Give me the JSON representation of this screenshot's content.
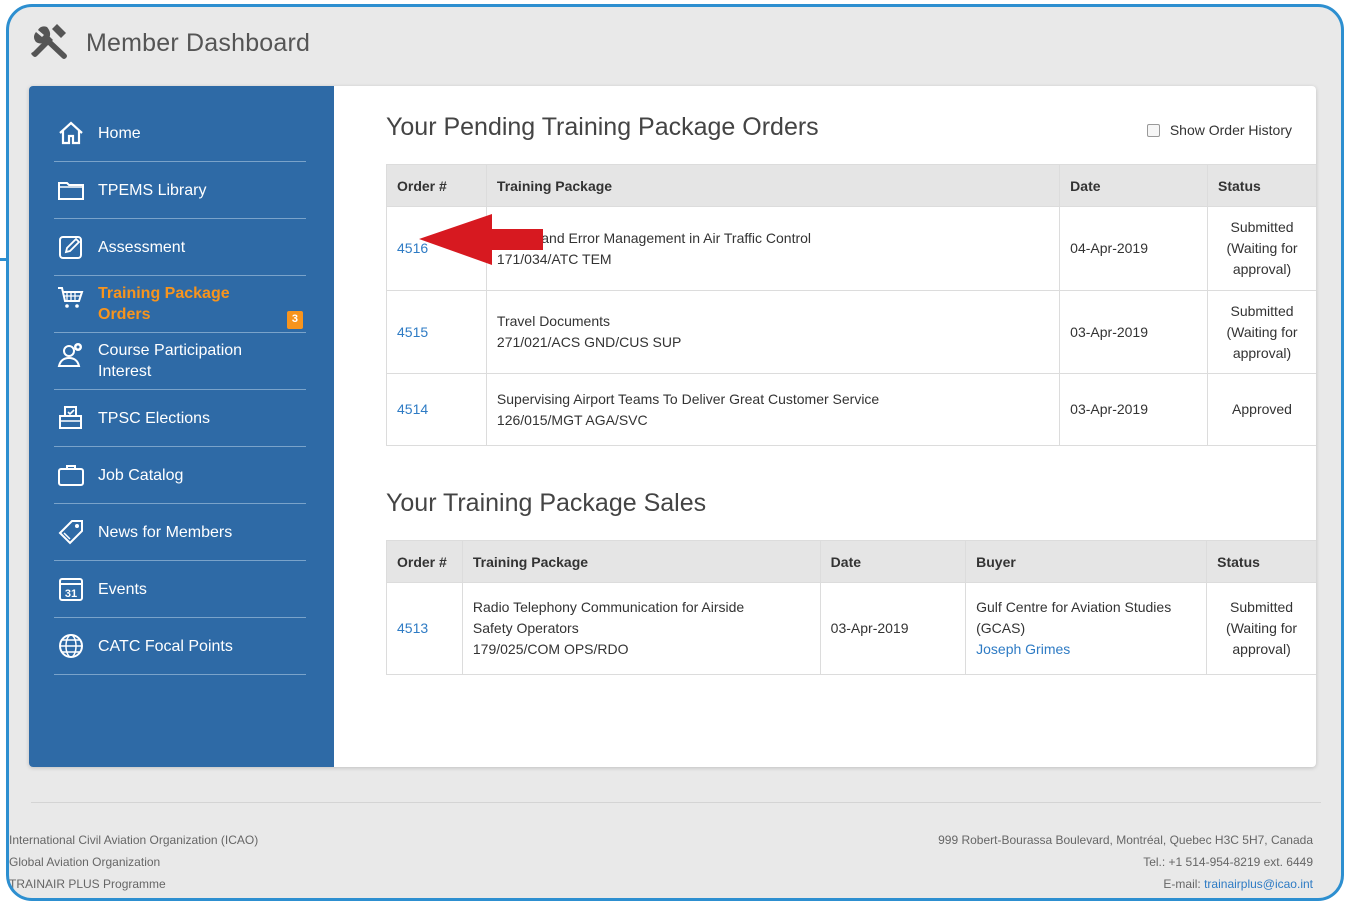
{
  "app": {
    "title": "Member Dashboard"
  },
  "sidebar": {
    "items": [
      {
        "label": "Home",
        "icon": "home-icon"
      },
      {
        "label": "TPEMS Library",
        "icon": "folder-icon"
      },
      {
        "label": "Assessment",
        "icon": "edit-icon"
      },
      {
        "label": "Training Package Orders",
        "icon": "cart-icon",
        "badge": "3",
        "active": true
      },
      {
        "label": "Course Participation Interest",
        "icon": "user-pin-icon"
      },
      {
        "label": "TPSC Elections",
        "icon": "ballot-box-icon"
      },
      {
        "label": "Job Catalog",
        "icon": "briefcase-icon"
      },
      {
        "label": "News for Members",
        "icon": "tag-icon"
      },
      {
        "label": "Events",
        "icon": "calendar-icon",
        "icon_text": "31"
      },
      {
        "label": "CATC Focal Points",
        "icon": "globe-icon"
      }
    ]
  },
  "pending": {
    "title": "Your Pending Training Package Orders",
    "show_history_label": "Show Order History",
    "columns": [
      "Order #",
      "Training Package",
      "Date",
      "Status"
    ],
    "rows": [
      {
        "order": "4516",
        "name": "Threat and Error Management in Air Traffic Control",
        "code": "171/034/ATC TEM",
        "date": "04-Apr-2019",
        "status": "Submitted (Waiting for approval)"
      },
      {
        "order": "4515",
        "name": "Travel Documents",
        "code": "271/021/ACS GND/CUS SUP",
        "date": "03-Apr-2019",
        "status": "Submitted (Waiting for approval)"
      },
      {
        "order": "4514",
        "name": "Supervising Airport Teams To Deliver Great Customer Service",
        "code": "126/015/MGT AGA/SVC",
        "date": "03-Apr-2019",
        "status": "Approved"
      }
    ]
  },
  "sales": {
    "title": "Your Training Package Sales",
    "columns": [
      "Order #",
      "Training Package",
      "Date",
      "Buyer",
      "Status"
    ],
    "rows": [
      {
        "order": "4513",
        "name": "Radio Telephony Communication for Airside Safety Operators",
        "code": "179/025/COM OPS/RDO",
        "date": "03-Apr-2019",
        "buyer_org": "Gulf Centre for Aviation Studies (GCAS)",
        "buyer_contact": "Joseph Grimes",
        "status": "Submitted (Waiting for approval)"
      }
    ]
  },
  "footer": {
    "left": [
      "International Civil Aviation Organization (ICAO)",
      "Global Aviation Organization",
      "TRAINAIR PLUS Programme"
    ],
    "address": "999 Robert-Bourassa Boulevard, Montréal, Quebec H3C 5H7, Canada",
    "phone": "Tel.: +1 514-954-8219 ext. 6449",
    "email_label": "E-mail: ",
    "email": "trainairplus@icao.int"
  },
  "colors": {
    "sidebar": "#2e6aa6",
    "accent": "#f7941d",
    "link": "#2e7bc4",
    "arrow": "#d71920",
    "frame": "#2d8fd0"
  }
}
